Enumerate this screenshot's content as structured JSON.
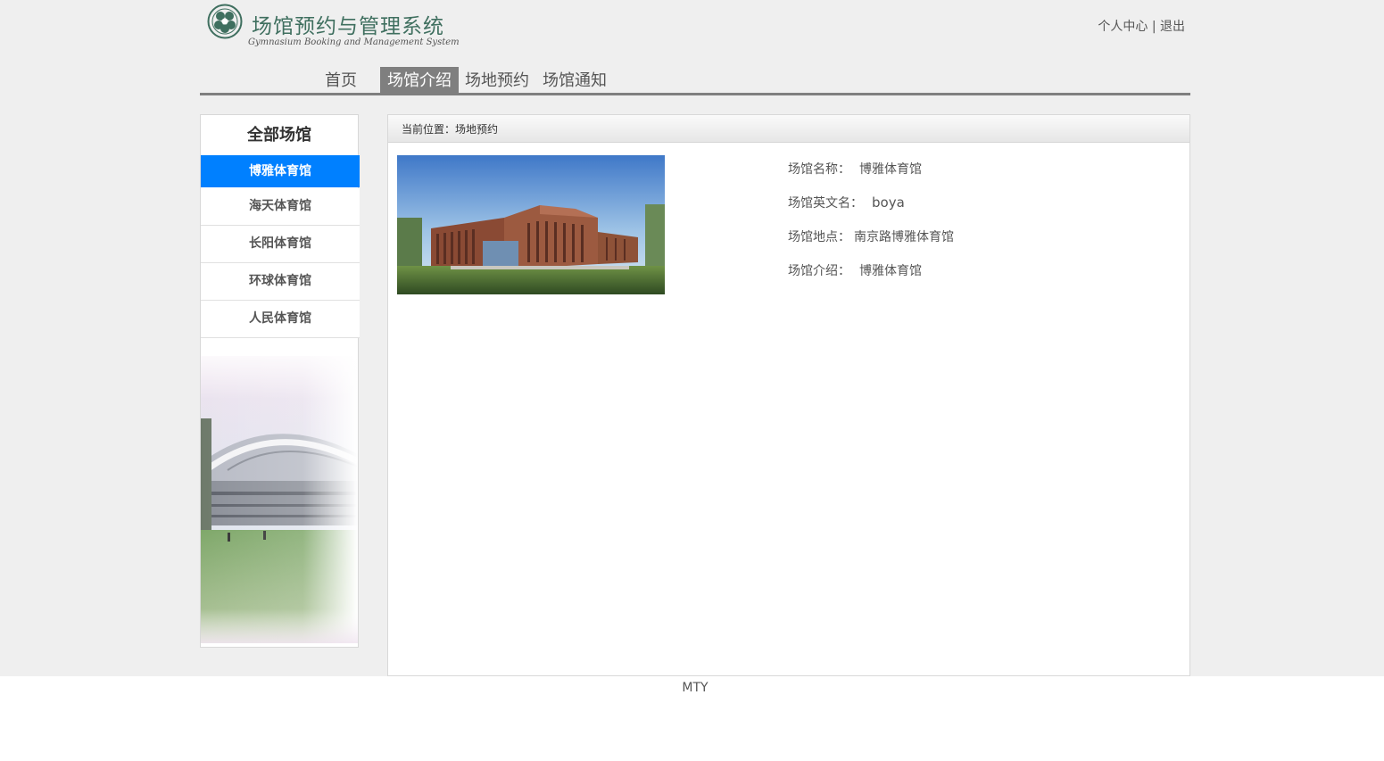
{
  "header": {
    "logo_title": "场馆预约与管理系统",
    "logo_subtitle": "Gymnasium Booking and Management System",
    "user_center": "个人中心",
    "separator": "|",
    "logout": "退出"
  },
  "nav": {
    "items": [
      {
        "label": "首页",
        "active": false
      },
      {
        "label": "场馆介绍",
        "active": true
      },
      {
        "label": "场地预约",
        "active": false
      },
      {
        "label": "场馆通知",
        "active": false
      }
    ]
  },
  "sidebar": {
    "title": "全部场馆",
    "items": [
      {
        "label": "博雅体育馆",
        "active": true
      },
      {
        "label": "海天体育馆",
        "active": false
      },
      {
        "label": "长阳体育馆",
        "active": false
      },
      {
        "label": "环球体育馆",
        "active": false
      },
      {
        "label": "人民体育馆",
        "active": false
      }
    ]
  },
  "breadcrumb": {
    "prefix": "当前位置：",
    "current": "场地预约"
  },
  "venue": {
    "name_label": "场馆名称：",
    "name": "博雅体育馆",
    "english_label": "场馆英文名：",
    "english": "boya",
    "location_label": "场馆地点：",
    "location": "南京路博雅体育馆",
    "intro_label": "场馆介绍：",
    "intro": "博雅体育馆"
  },
  "footer": {
    "text": "MTY"
  },
  "colors": {
    "page_bg": "#efefef",
    "accent": "#0080ff",
    "nav_active": "#7f7f7f",
    "logo_green": "#3f6f5f"
  }
}
